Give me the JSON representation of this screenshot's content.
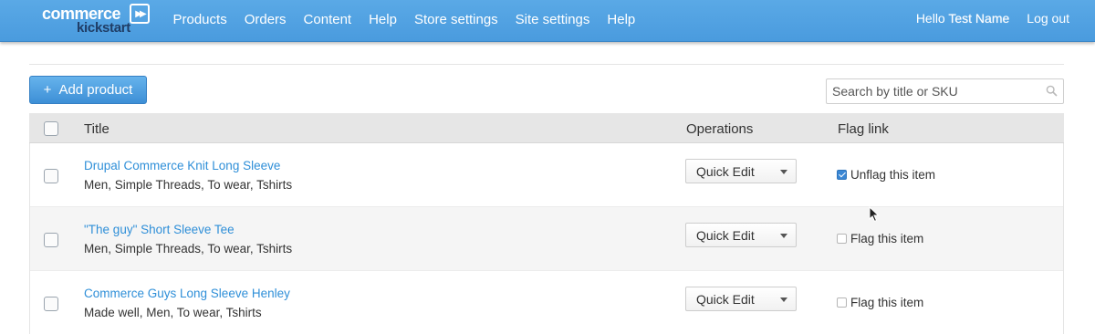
{
  "brand": {
    "line1": "commerce",
    "line2": "kickstart",
    "mark": "▶▶"
  },
  "nav": {
    "items": [
      "Products",
      "Orders",
      "Content",
      "Help",
      "Store settings",
      "Site settings",
      "Help"
    ]
  },
  "user": {
    "greeting": "Hello",
    "name": "Test Name",
    "logout": "Log out"
  },
  "toolbar": {
    "add_plus": "+",
    "add_label": "Add product",
    "search_placeholder": "Search by title or SKU",
    "search_icon": "search-icon"
  },
  "table": {
    "headers": {
      "title": "Title",
      "operations": "Operations",
      "flag": "Flag link"
    },
    "rows": [
      {
        "title": "Drupal Commerce Knit Long Sleeve",
        "tags": "Men, Simple Threads, To wear, Tshirts",
        "operation": "Quick Edit",
        "flag_label": "Unflag this item",
        "flagged": true
      },
      {
        "title": "\"The guy\" Short Sleeve Tee",
        "tags": "Men, Simple Threads, To wear, Tshirts",
        "operation": "Quick Edit",
        "flag_label": "Flag this item",
        "flagged": false
      },
      {
        "title": "Commerce Guys Long Sleeve Henley",
        "tags": "Made well, Men, To wear, Tshirts",
        "operation": "Quick Edit",
        "flag_label": "Flag this item",
        "flagged": false
      }
    ]
  },
  "colors": {
    "navbar": "#4a9bde",
    "link": "#2f8fd8",
    "button": "#3d8fd6"
  }
}
